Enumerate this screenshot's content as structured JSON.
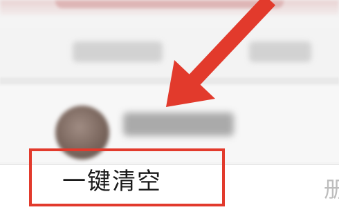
{
  "colors": {
    "annotation_red": "#e23a2c",
    "background": "#f4f4f4",
    "row_background": "#ffffff"
  },
  "bottom_row": {
    "clear_all_label": "一键清空",
    "delete_label_partial": "册"
  },
  "annotation": {
    "arrow_icon": "red-arrow-icon",
    "highlight_box": "red-rectangle-highlight"
  }
}
